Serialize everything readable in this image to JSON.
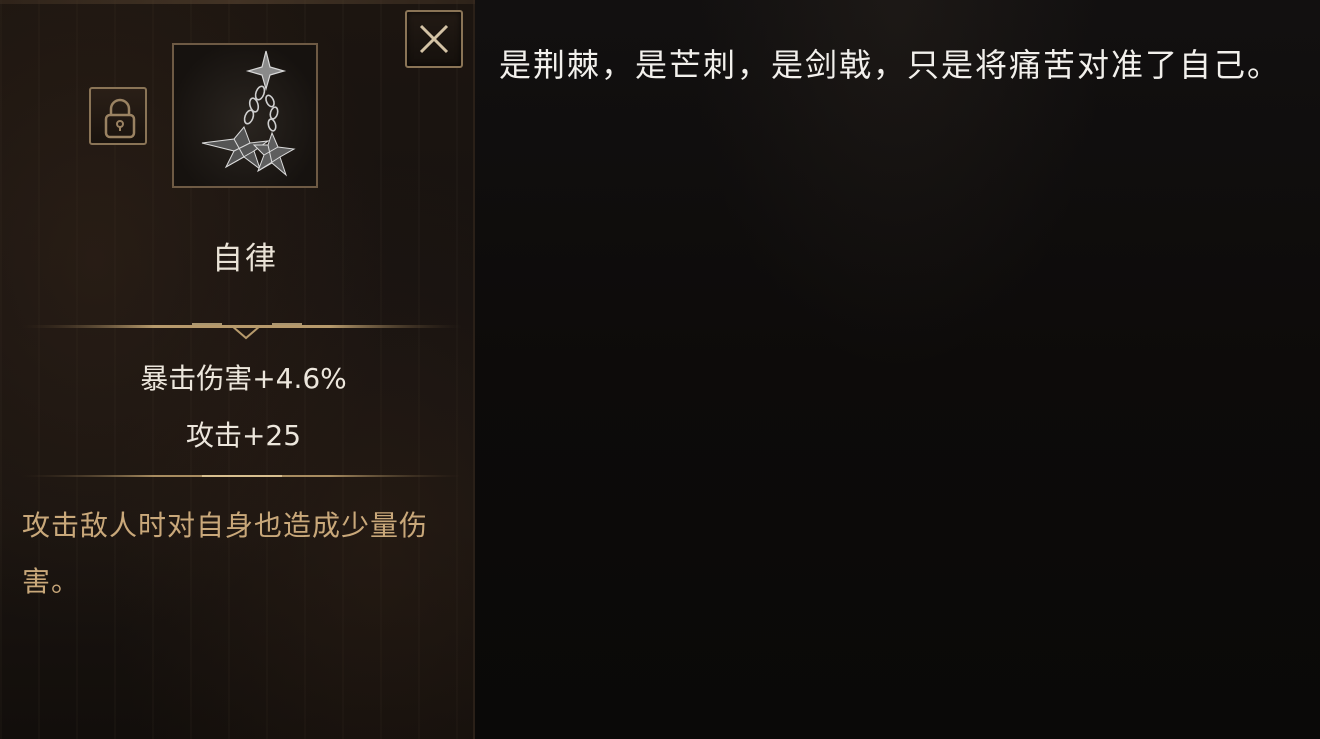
{
  "item": {
    "name": "自律",
    "icon": "spiked-flail-icon",
    "locked": true
  },
  "stats": [
    "暴击伤害+4.6%",
    "攻击+25"
  ],
  "description": "攻击敌人时对自身也造成少量伤害。",
  "lore": "是荆棘，是芒刺，是剑戟，只是将痛苦对准了自己。",
  "colors": {
    "frame_gold": "#8a7456",
    "stat_text": "#ece6dc",
    "description_text": "#c9a87a",
    "lore_text": "#f2f0ec"
  }
}
